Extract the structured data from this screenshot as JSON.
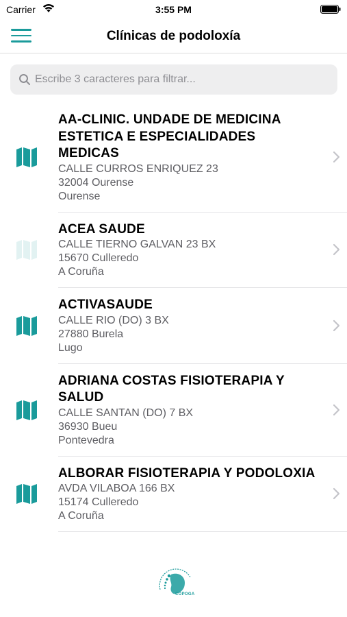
{
  "status_bar": {
    "carrier": "Carrier",
    "time": "3:55 PM"
  },
  "nav": {
    "title": "Clínicas de podoloxía"
  },
  "search": {
    "placeholder": "Escribe 3 caracteres para filtrar..."
  },
  "clinics": [
    {
      "name": "AA-CLINIC. UNDADE DE MEDICINA ESTETICA E ESPECIALIDADES MEDICAS",
      "street": "CALLE CURROS ENRIQUEZ 23",
      "postal": "32004 Ourense",
      "province": "Ourense"
    },
    {
      "name": "ACEA SAUDE",
      "street": "CALLE TIERNO GALVAN 23 BX",
      "postal": "15670 Culleredo",
      "province": "A Coruña"
    },
    {
      "name": "ACTIVASAUDE",
      "street": "CALLE RIO (DO) 3 BX",
      "postal": "27880 Burela",
      "province": "Lugo"
    },
    {
      "name": "ADRIANA COSTAS FISIOTERAPIA Y SALUD",
      "street": "CALLE SANTAN (DO) 7 BX",
      "postal": "36930 Bueu",
      "province": "Pontevedra"
    },
    {
      "name": "ALBORAR FISIOTERAPIA Y PODOLOXIA",
      "street": "AVDA VILABOA 166 BX",
      "postal": "15174 Culleredo",
      "province": "A Coruña"
    }
  ],
  "footer": {
    "logo_text": "COPOGA"
  },
  "colors": {
    "accent": "#1a9b9b",
    "secondary_text": "#5e5e63",
    "search_bg": "#eeeeef"
  }
}
